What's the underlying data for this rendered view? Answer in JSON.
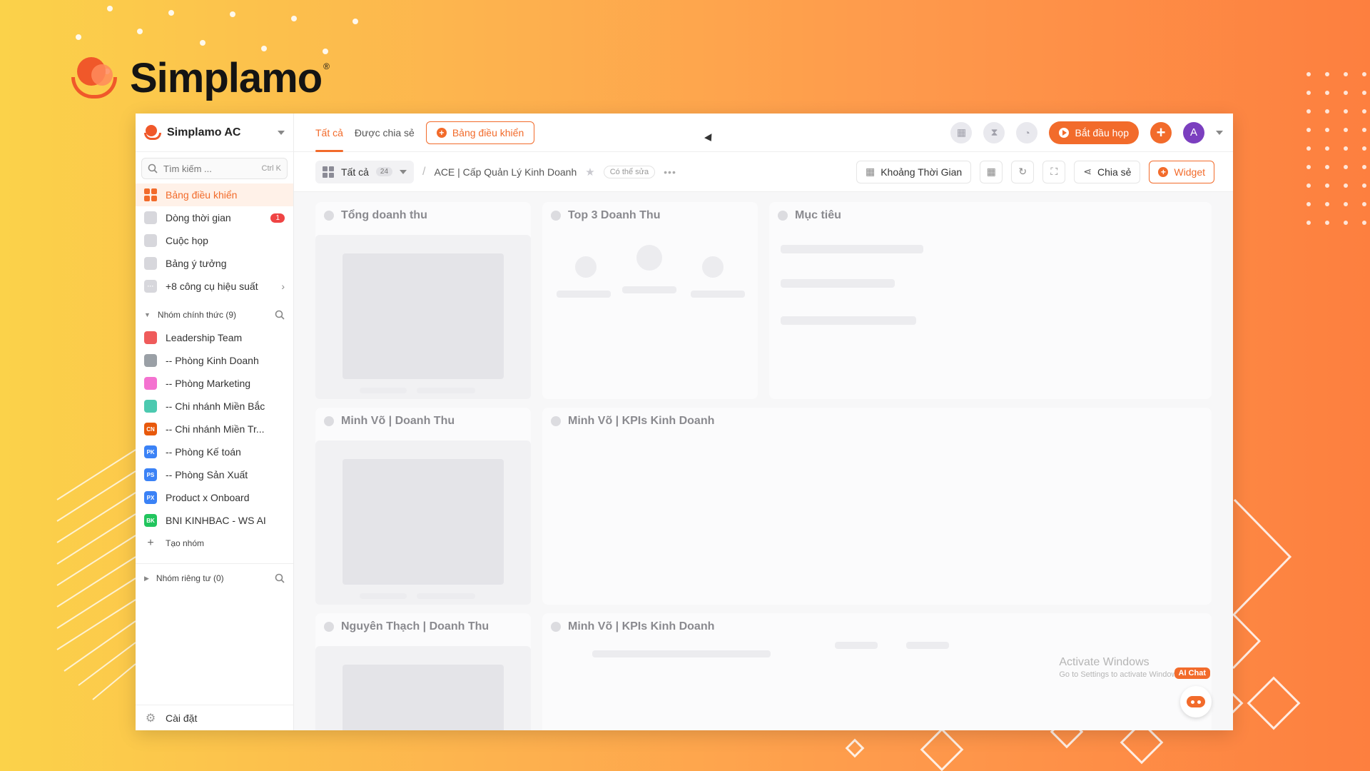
{
  "brand": {
    "name": "Simplamo",
    "registered": "®"
  },
  "workspace": {
    "name": "Simplamo AC"
  },
  "search": {
    "placeholder": "Tìm kiếm ...",
    "shortcut": "Ctrl K"
  },
  "nav": {
    "items": [
      {
        "label": "Bảng điều khiển",
        "icon": "dashboard-icon",
        "active": true
      },
      {
        "label": "Dòng thời gian",
        "icon": "timeline-icon",
        "badge": "1"
      },
      {
        "label": "Cuộc họp",
        "icon": "meeting-icon"
      },
      {
        "label": "Bảng ý tưởng",
        "icon": "idea-icon"
      },
      {
        "label": "+8 công cụ hiệu suất",
        "icon": "more-tools-icon"
      }
    ]
  },
  "groups": {
    "official_title": "Nhóm chính thức (9)",
    "items": [
      {
        "label": "Leadership Team",
        "abbr": "",
        "color": "#ef5b5b"
      },
      {
        "label": "-- Phòng Kinh Doanh",
        "abbr": "",
        "color": "#9aa0a6"
      },
      {
        "label": "-- Phòng Marketing",
        "abbr": "",
        "color": "#f472d0"
      },
      {
        "label": "-- Chi nhánh Miền Bắc",
        "abbr": "",
        "color": "#4cc9b0"
      },
      {
        "label": "-- Chi nhánh Miền Tr...",
        "abbr": "CN",
        "color": "#e8590c"
      },
      {
        "label": "-- Phòng Kế toán",
        "abbr": "PK",
        "color": "#3b82f6"
      },
      {
        "label": "-- Phòng Sản Xuất",
        "abbr": "PS",
        "color": "#3b82f6"
      },
      {
        "label": "Product x Onboard",
        "abbr": "PX",
        "color": "#3b82f6"
      },
      {
        "label": "BNI KINHBAC - WS AI",
        "abbr": "BK",
        "color": "#22c55e"
      }
    ],
    "create_label": "Tạo nhóm",
    "private_title": "Nhóm riêng tư (0)"
  },
  "settings_label": "Cài đặt",
  "topbar": {
    "tabs": [
      "Tất cả",
      "Được chia sẻ"
    ],
    "new_dashboard": "Bảng điều khiển",
    "start_meeting": "Bắt đầu họp",
    "avatar_letter": "A"
  },
  "toolbar": {
    "filter_label": "Tất cả",
    "filter_count": "24",
    "breadcrumb": "ACE | Cấp Quản Lý Kinh Doanh",
    "editable": "Có thể sửa",
    "more": "•••",
    "time_range": "Khoảng Thời Gian",
    "share": "Chia sẻ",
    "widget": "Widget"
  },
  "widgets": [
    {
      "title": "Tổng doanh thu"
    },
    {
      "title": "Top 3 Doanh Thu"
    },
    {
      "title": "Mục tiêu"
    },
    {
      "title": "Minh Võ | Doanh Thu"
    },
    {
      "title": "Minh Võ | KPIs Kinh Doanh"
    },
    {
      "title": "Nguyên Thạch | Doanh Thu"
    },
    {
      "title": "Minh Võ | KPIs Kinh Doanh"
    }
  ],
  "watermark": {
    "title": "Activate Windows",
    "subtitle": "Go to Settings to activate Windows."
  },
  "ai_chat": {
    "label": "AI Chat"
  },
  "colors": {
    "accent": "#f26b2b"
  }
}
